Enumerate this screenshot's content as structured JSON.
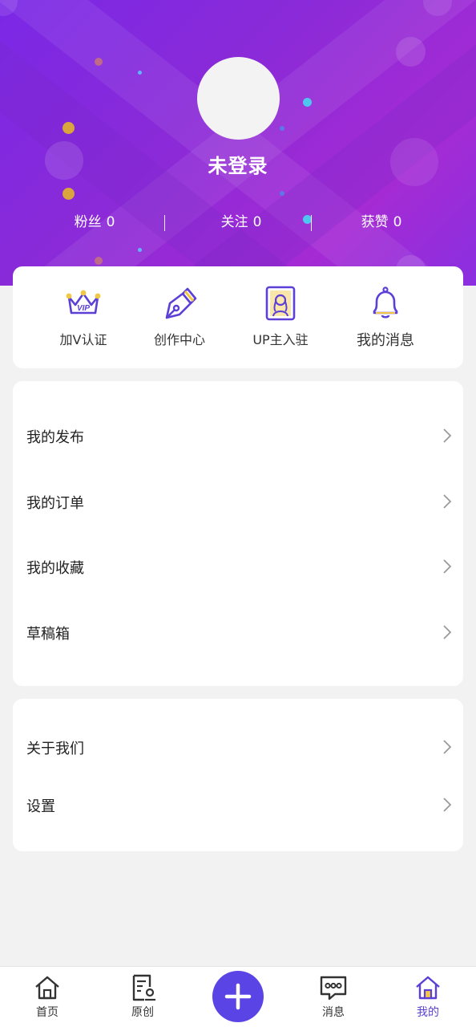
{
  "profile": {
    "username": "未登录",
    "stats": [
      {
        "label": "粉丝",
        "value": "0"
      },
      {
        "label": "关注",
        "value": "0"
      },
      {
        "label": "获赞",
        "value": "0"
      }
    ]
  },
  "quick_actions": [
    {
      "label": "加V认证",
      "icon": "vip-crown-icon"
    },
    {
      "label": "创作中心",
      "icon": "pen-nib-icon"
    },
    {
      "label": "UP主入驻",
      "icon": "creator-portrait-icon"
    },
    {
      "label": "我的消息",
      "icon": "bell-icon"
    }
  ],
  "menu_primary": [
    {
      "label": "我的发布"
    },
    {
      "label": "我的订单"
    },
    {
      "label": "我的收藏"
    },
    {
      "label": "草稿箱"
    }
  ],
  "menu_secondary": [
    {
      "label": "关于我们"
    },
    {
      "label": "设置"
    }
  ],
  "tabbar": {
    "items": [
      {
        "label": "首页",
        "icon": "home-icon"
      },
      {
        "label": "原创",
        "icon": "original-doc-icon"
      },
      {
        "label": "",
        "icon": "plus-icon"
      },
      {
        "label": "消息",
        "icon": "chat-bubble-icon"
      },
      {
        "label": "我的",
        "icon": "home-active-icon"
      }
    ],
    "active": "我的"
  },
  "colors": {
    "accent": "#5b3fd6",
    "hero_start": "#7a28e6",
    "hero_end": "#a52bd4"
  }
}
